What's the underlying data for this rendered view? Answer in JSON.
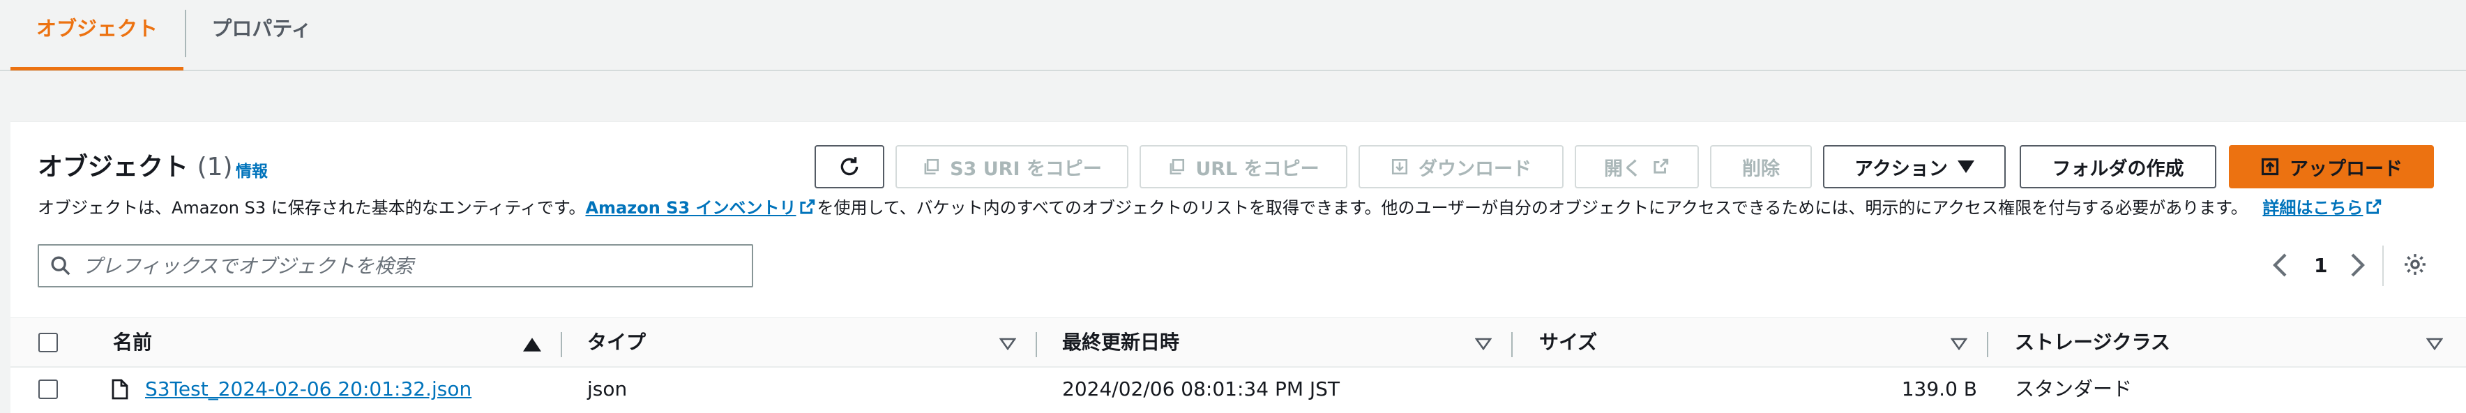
{
  "tabs": [
    {
      "label": "オブジェクト",
      "active": true
    },
    {
      "label": "プロパティ",
      "active": false
    }
  ],
  "header": {
    "title": "オブジェクト",
    "count": "(1)",
    "info": "情報"
  },
  "description": {
    "text1": "オブジェクトは、Amazon S3 に保存された基本的なエンティティです。",
    "link1": "Amazon S3 インベントリ",
    "text2": "を使用して、バケット内のすべてのオブジェクトのリストを取得できます。他のユーザーが自分のオブジェクトにアクセスできるためには、明示的にアクセス権限を付与する必要があります。",
    "link2": "詳細はこちら"
  },
  "toolbar": {
    "copy_s3_uri": "S3 URI をコピー",
    "copy_url": "URL をコピー",
    "download": "ダウンロード",
    "open": "開く",
    "delete": "削除",
    "actions": "アクション",
    "create_folder": "フォルダの作成",
    "upload": "アップロード"
  },
  "search": {
    "placeholder": "プレフィックスでオブジェクトを検索"
  },
  "pagination": {
    "current_page": "1"
  },
  "table": {
    "columns": [
      "名前",
      "タイプ",
      "最終更新日時",
      "サイズ",
      "ストレージクラス"
    ],
    "rows": [
      {
        "name": "S3Test_2024-02-06 20:01:32.json",
        "type": "json",
        "last_modified": "2024/02/06 08:01:34 PM JST",
        "size": "139.0 B",
        "storage_class": "スタンダード"
      }
    ]
  },
  "colors": {
    "accent": "#ec7211",
    "link": "#0073bb",
    "text": "#16191f",
    "disabled": "#aab7b8",
    "background": "#f2f3f3"
  }
}
